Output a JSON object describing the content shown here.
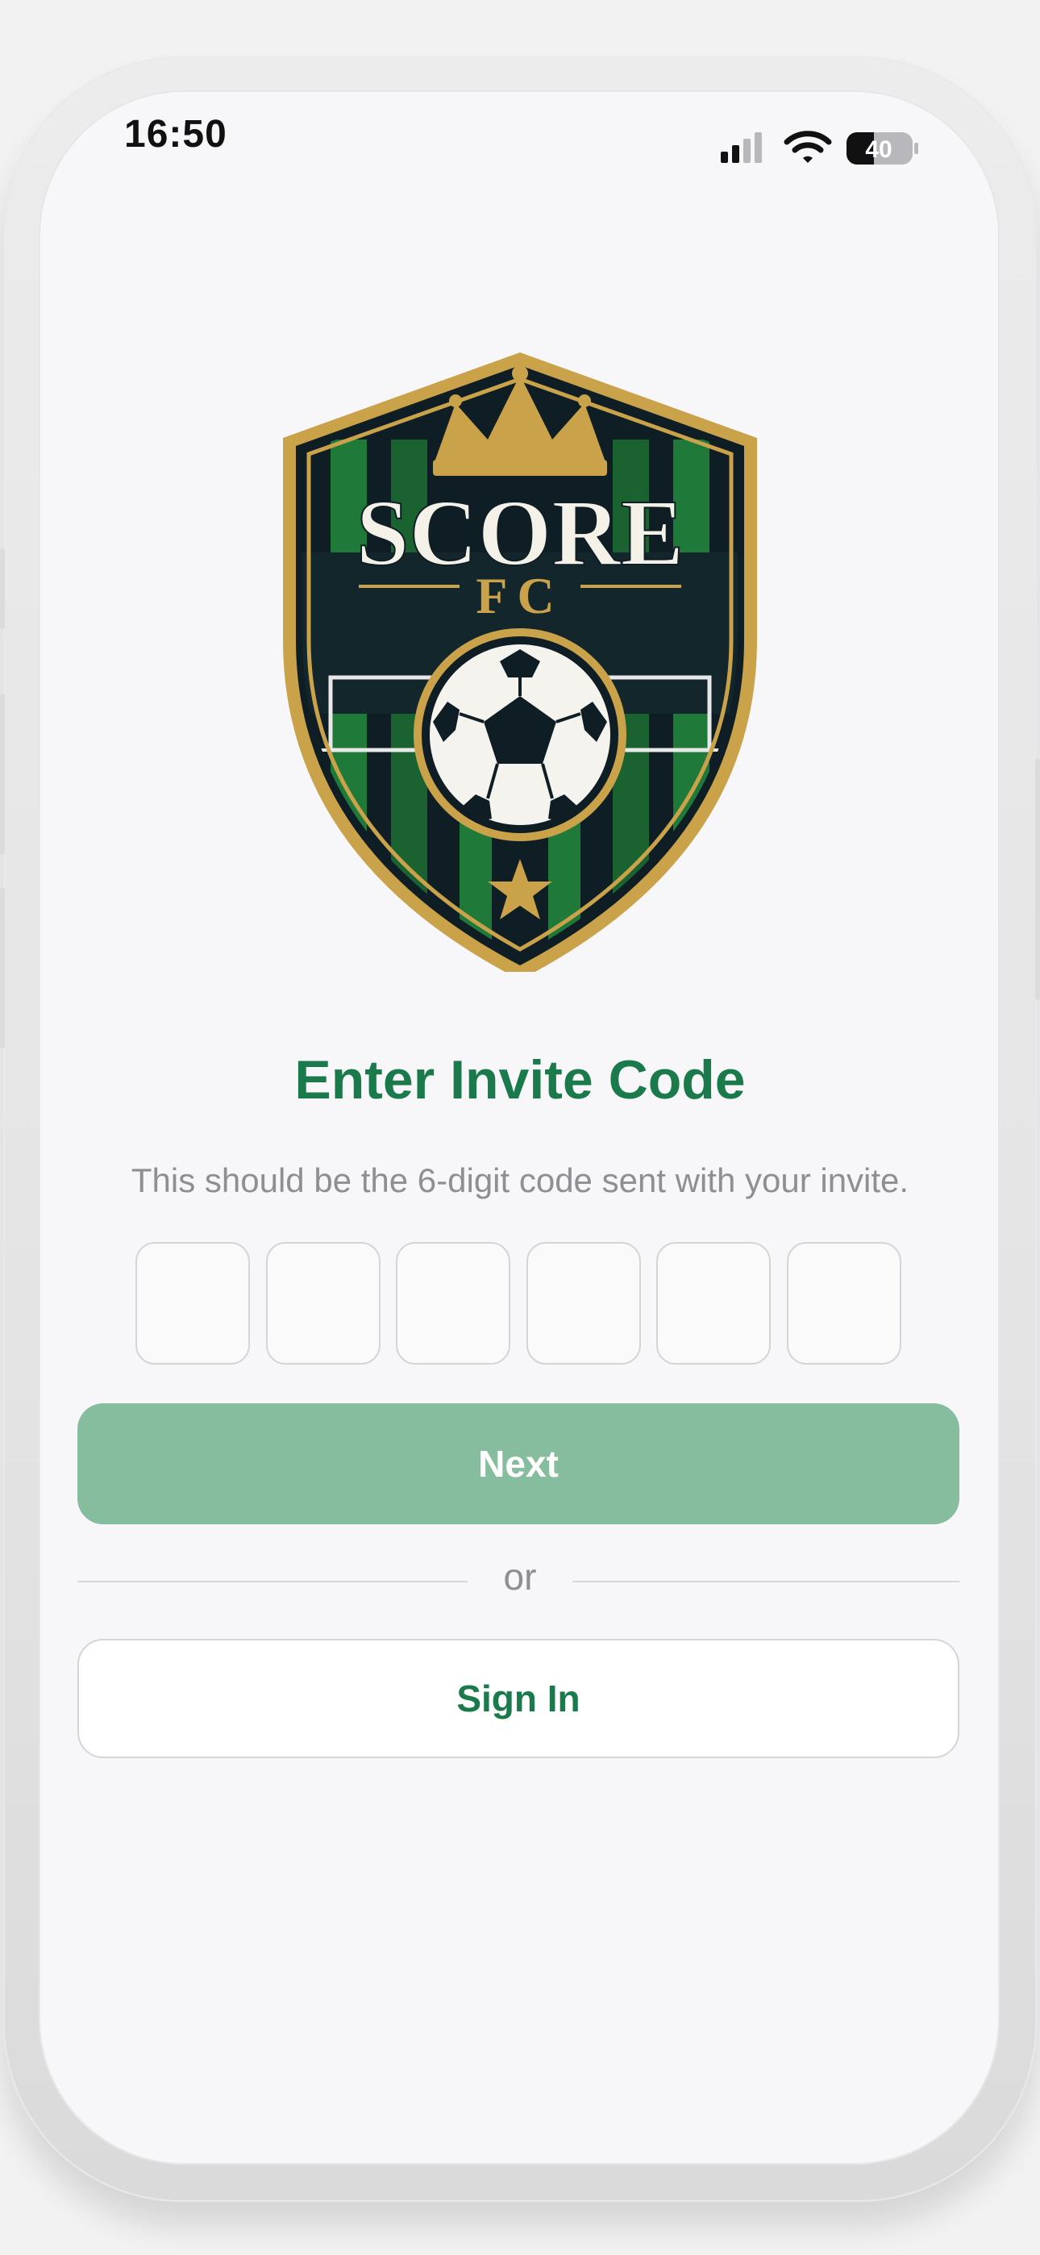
{
  "status_bar": {
    "time": "16:50",
    "battery": "40",
    "icons": [
      "cellular-signal-icon",
      "wifi-icon",
      "battery-icon"
    ]
  },
  "logo": {
    "top_text": "SCORE",
    "bottom_text": "FC",
    "colors": {
      "gold": "#c9a24a",
      "green": "#1f7a3a",
      "dark": "#0f1e24"
    }
  },
  "invite": {
    "title": "Enter Invite Code",
    "subtitle": "This should be the 6-digit code sent with your invite.",
    "code_digits": [
      "",
      "",
      "",
      "",
      "",
      ""
    ]
  },
  "actions": {
    "next_label": "Next",
    "or_label": "or",
    "signin_label": "Sign In"
  },
  "theme": {
    "accent": "#1a7a4c",
    "next_button_disabled": "#86bd9f",
    "secondary_text": "#8e8e93"
  }
}
